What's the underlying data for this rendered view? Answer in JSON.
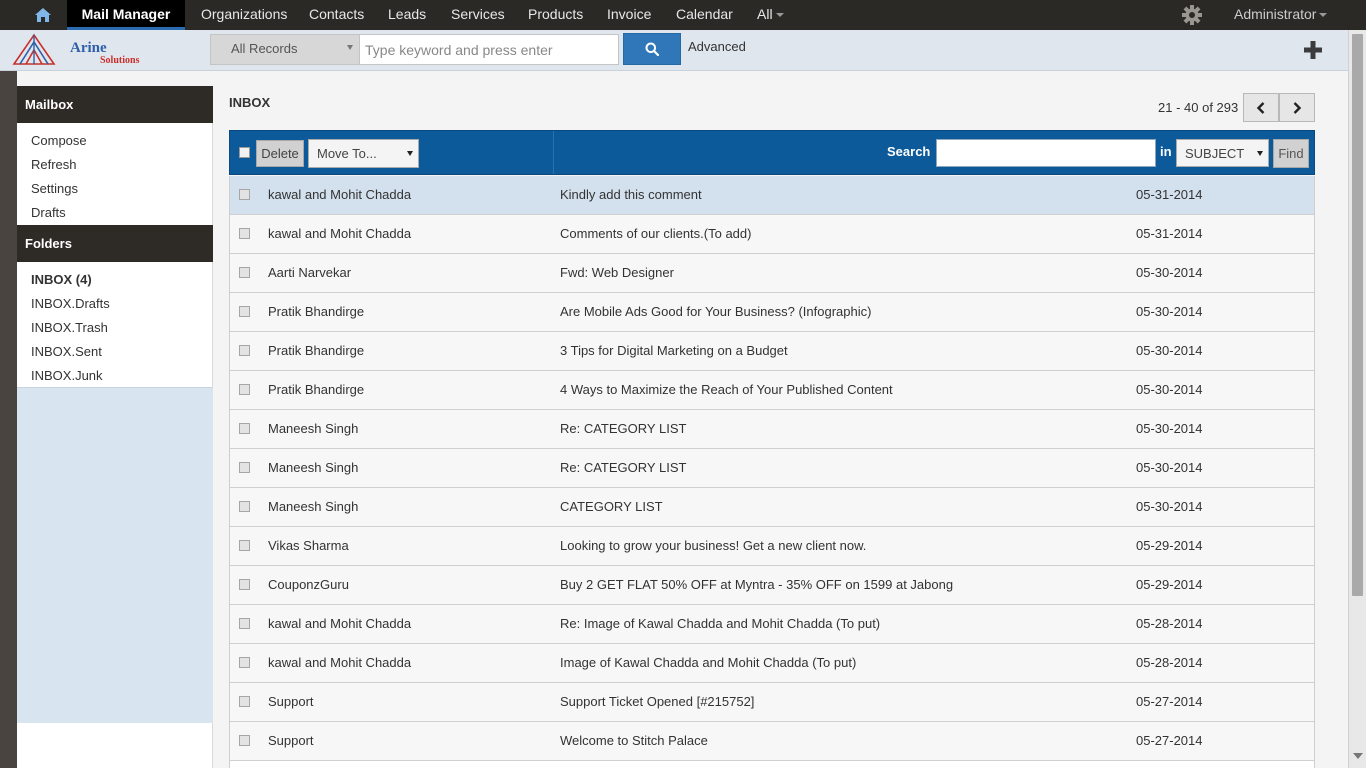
{
  "topnav": {
    "active": "Mail Manager",
    "items": [
      "Organizations",
      "Contacts",
      "Leads",
      "Services",
      "Products",
      "Invoice",
      "Calendar",
      "All"
    ],
    "user": "Administrator"
  },
  "header": {
    "logo_name": "Arine",
    "logo_sub": "Solutions",
    "records_select": "All Records",
    "search_placeholder": "Type keyword and press enter",
    "advanced": "Advanced"
  },
  "sidebar": {
    "mailbox_title": "Mailbox",
    "mailbox_items": [
      "Compose",
      "Refresh",
      "Settings",
      "Drafts"
    ],
    "folders_title": "Folders",
    "folder_items": [
      "INBOX (4)",
      "INBOX.Drafts",
      "INBOX.Trash",
      "INBOX.Sent",
      "INBOX.Junk"
    ]
  },
  "main": {
    "title": "INBOX",
    "pager": "21 - 40 of 293",
    "toolbar": {
      "delete": "Delete",
      "move_to": "Move To...",
      "search_label": "Search",
      "in_label": "in",
      "field": "SUBJECT",
      "find": "Find"
    },
    "messages": [
      {
        "from": "kawal and Mohit Chadda",
        "subject": "Kindly add this comment",
        "date": "05-31-2014"
      },
      {
        "from": "kawal and Mohit Chadda",
        "subject": "Comments of our clients.(To add)",
        "date": "05-31-2014"
      },
      {
        "from": "Aarti Narvekar",
        "subject": "Fwd: Web Designer",
        "date": "05-30-2014"
      },
      {
        "from": "Pratik Bhandirge",
        "subject": "Are Mobile Ads Good for Your Business? (Infographic)",
        "date": "05-30-2014"
      },
      {
        "from": "Pratik Bhandirge",
        "subject": "3 Tips for Digital Marketing on a Budget",
        "date": "05-30-2014"
      },
      {
        "from": "Pratik Bhandirge",
        "subject": "4 Ways to Maximize the Reach of Your Published Content",
        "date": "05-30-2014"
      },
      {
        "from": "Maneesh Singh",
        "subject": "Re: CATEGORY LIST",
        "date": "05-30-2014"
      },
      {
        "from": "Maneesh Singh",
        "subject": "Re: CATEGORY LIST",
        "date": "05-30-2014"
      },
      {
        "from": "Maneesh Singh",
        "subject": "CATEGORY LIST",
        "date": "05-30-2014"
      },
      {
        "from": "Vikas Sharma",
        "subject": "Looking to grow your business! Get a new client now.",
        "date": "05-29-2014"
      },
      {
        "from": "CouponzGuru",
        "subject": "Buy 2 GET FLAT 50% OFF at Myntra - 35% OFF on 1599 at Jabong",
        "date": "05-29-2014"
      },
      {
        "from": "kawal and Mohit Chadda",
        "subject": "Re: Image of Kawal Chadda and Mohit Chadda (To put)",
        "date": "05-28-2014"
      },
      {
        "from": "kawal and Mohit Chadda",
        "subject": "Image of Kawal Chadda and Mohit Chadda (To put)",
        "date": "05-28-2014"
      },
      {
        "from": "Support",
        "subject": "Support Ticket Opened [#215752]",
        "date": "05-27-2014"
      },
      {
        "from": "Support",
        "subject": "Welcome to Stitch Palace",
        "date": "05-27-2014"
      }
    ]
  },
  "colors": {
    "topnav_bg": "#2b2926",
    "toolbar_bg": "#0c5a9a",
    "search_button": "#2f77b9",
    "selected_row": "#d3e0ed",
    "sidebar_header": "#2e2a26"
  },
  "icons": [
    "home-icon",
    "gear-icon",
    "search-icon",
    "plus-icon",
    "chevron-left-icon",
    "chevron-right-icon"
  ]
}
